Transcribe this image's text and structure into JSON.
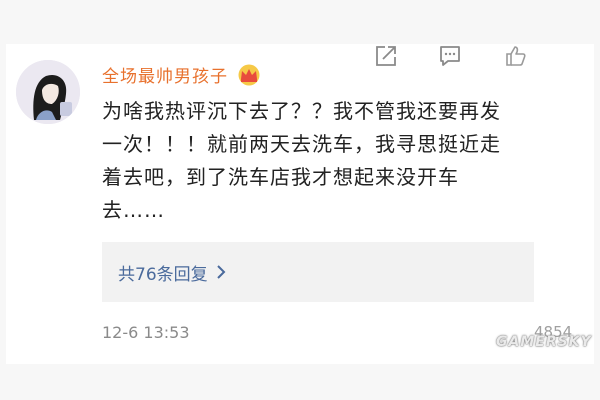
{
  "comment": {
    "username": "全场最帅男孩子",
    "badge_icon": "crown-icon",
    "text_lines": [
      "为啥我热评沉下去了？？我不管我还要再发",
      "一次！！！就前两天去洗车，我寻思挺近走",
      "着去吧，到了洗车店我才想起来没开车",
      "去……"
    ],
    "replies_label": "共76条回复",
    "timestamp": "12-6 13:53",
    "like_count": "4854"
  },
  "actions": {
    "share_icon": "share-icon",
    "reply_icon": "comment-icon",
    "like_icon": "thumbs-up-icon"
  },
  "watermark": "GAMERSKY",
  "colors": {
    "username": "#e8712d",
    "link": "#4a6a9c",
    "text": "#222222",
    "muted": "#8a8a8a",
    "replies_bg": "#f2f2f2"
  }
}
